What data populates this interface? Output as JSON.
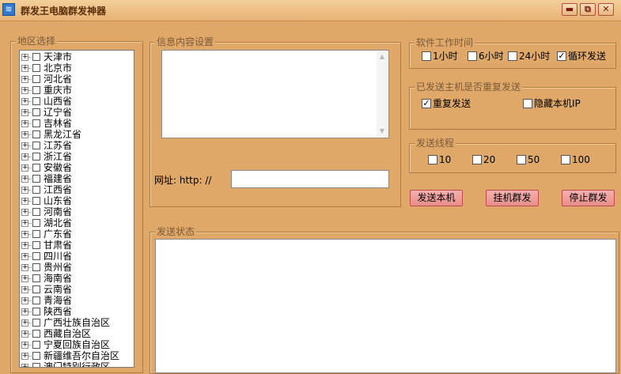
{
  "window": {
    "title": "群发王电脑群发神器",
    "minimize": "▬",
    "restore": "⧉",
    "close": "✕"
  },
  "region_group": {
    "legend": "地区选择",
    "items": [
      "天津市",
      "北京市",
      "河北省",
      "重庆市",
      "山西省",
      "辽宁省",
      "吉林省",
      "黑龙江省",
      "江苏省",
      "浙江省",
      "安徽省",
      "福建省",
      "江西省",
      "山东省",
      "河南省",
      "湖北省",
      "广东省",
      "甘肃省",
      "四川省",
      "贵州省",
      "海南省",
      "云南省",
      "青海省",
      "陕西省",
      "广西壮族自治区",
      "西藏自治区",
      "宁夏回族自治区",
      "新疆维吾尔自治区",
      "澳门特别行政区"
    ]
  },
  "message_group": {
    "legend": "信息内容设置",
    "url_label": "网址: http: //",
    "url_value": ""
  },
  "work_time_group": {
    "legend": "软件工作时间",
    "options": [
      {
        "label": "1小时",
        "checked": false
      },
      {
        "label": "6小时",
        "checked": false
      },
      {
        "label": "24小时",
        "checked": false
      },
      {
        "label": "循环发送",
        "checked": true
      }
    ]
  },
  "resend_group": {
    "legend": "已发送主机是否重复发送",
    "options": [
      {
        "label": "重复发送",
        "checked": true
      },
      {
        "label": "隐藏本机IP",
        "checked": false
      }
    ]
  },
  "threads_group": {
    "legend": "发送线程",
    "options": [
      {
        "label": "10",
        "checked": false
      },
      {
        "label": "20",
        "checked": false
      },
      {
        "label": "50",
        "checked": false
      },
      {
        "label": "100",
        "checked": false
      }
    ]
  },
  "buttons": {
    "send_local": "发送本机",
    "auto_send": "挂机群发",
    "stop_send": "停止群发"
  },
  "status_group": {
    "legend": "发送状态"
  },
  "icons": {
    "app": "app-icon",
    "checkmark": "✓",
    "expand": "+",
    "scroll_up": "▲",
    "scroll_down": "▼"
  },
  "colors": {
    "background": "#e0a868",
    "button": "#f0a4a2",
    "button_border": "#c24a4a"
  }
}
